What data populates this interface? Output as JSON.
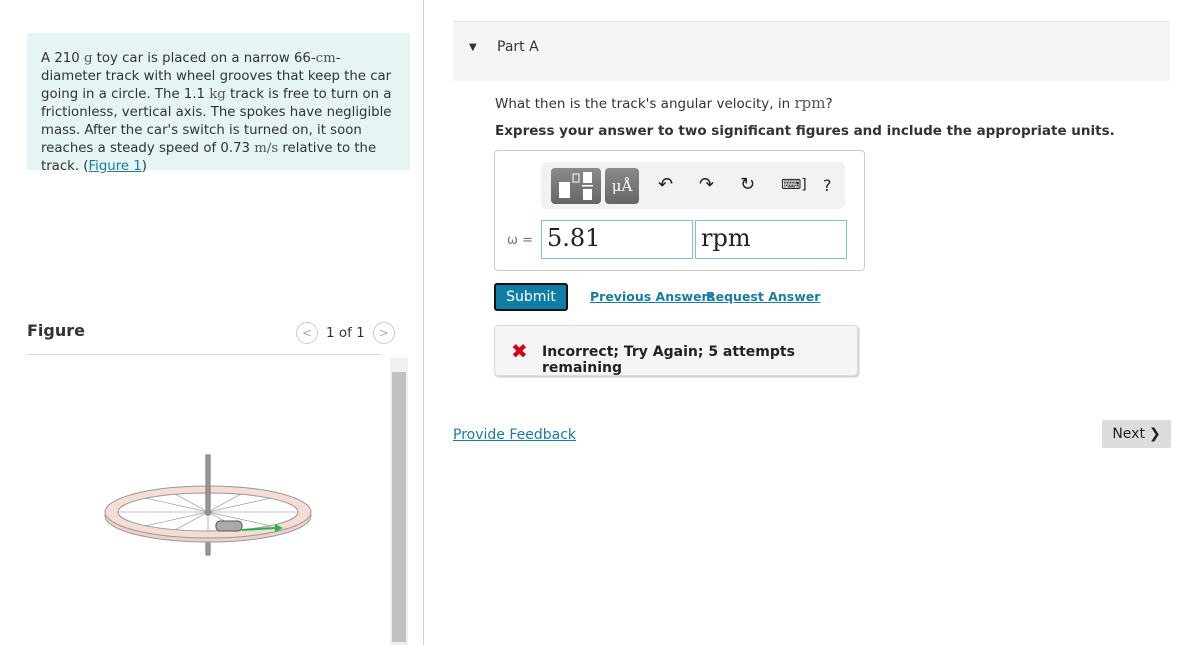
{
  "problem": {
    "parts": [
      "A 210 ",
      "g",
      " toy car is placed on a narrow 66-",
      "cm",
      "-diameter track with wheel grooves that keep the car going in a circle. The 1.1 ",
      "kg",
      " track is free to turn on a frictionless, vertical axis. The spokes have negligible mass. After the car's switch is turned on, it soon reaches a steady speed of 0.73 ",
      "m/s",
      " relative to the track. ("
    ],
    "figure_link": "Figure 1",
    "close": ")"
  },
  "figure": {
    "label": "Figure",
    "pager": "1 of 1",
    "prev_icon": "chevron-left",
    "next_icon": "chevron-right"
  },
  "part": {
    "title": "Part A",
    "question_pre": "What then is the track's angular velocity, in ",
    "question_unit": "rpm",
    "question_post": "?",
    "instruction": "Express your answer to two significant figures and include the appropriate units."
  },
  "answer": {
    "symbol": "ω =",
    "value": "5.81",
    "units": "rpm",
    "tool_units": "μÅ",
    "help": "?"
  },
  "actions": {
    "submit": "Submit",
    "previous": "Previous Answers",
    "request": "Request Answer"
  },
  "feedback": {
    "text": "Incorrect; Try Again; 5 attempts remaining",
    "color": "#d0021b"
  },
  "footer": {
    "provide_feedback": "Provide Feedback",
    "next": "Next"
  }
}
